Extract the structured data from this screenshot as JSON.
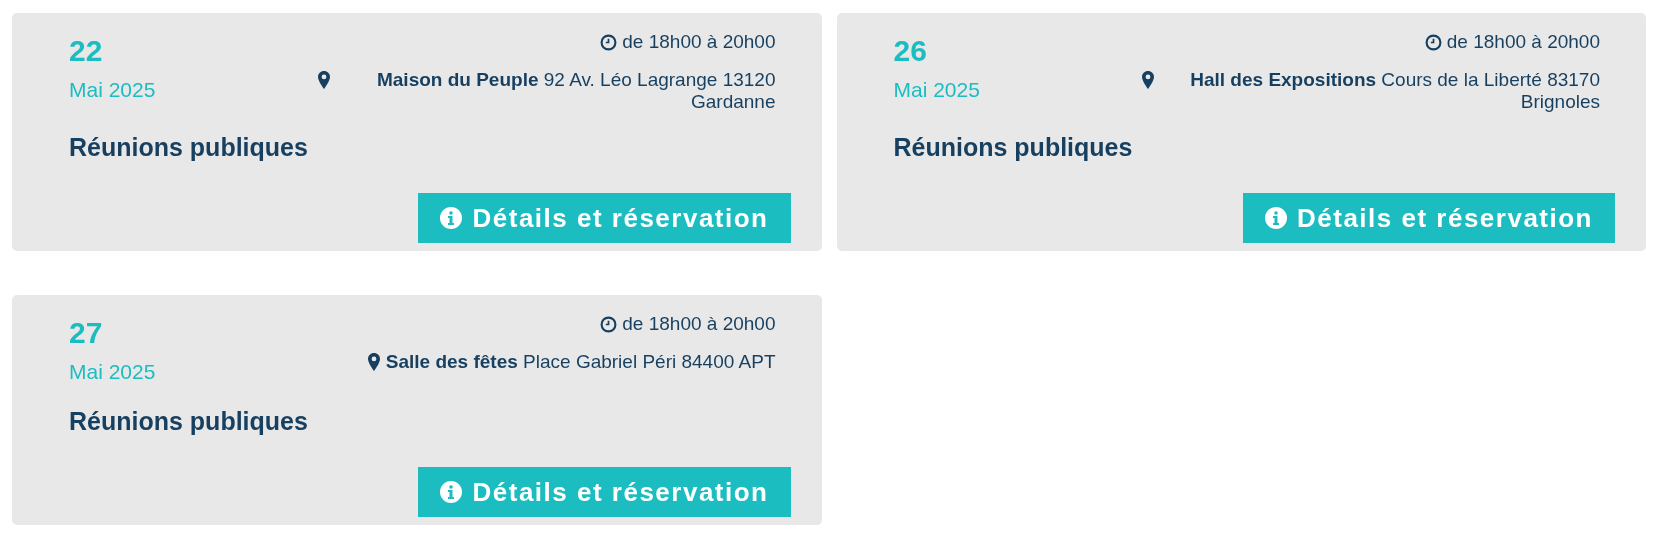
{
  "events": [
    {
      "day": "22",
      "month": "Mai 2025",
      "time": "de 18h00 à 20h00",
      "location": "**Maison du Peuple** 92 Av. Léo Lagrange 13120 Gardanne",
      "title": "Réunions publiques",
      "button": "Détails et réservation"
    },
    {
      "day": "26",
      "month": "Mai 2025",
      "time": "de 18h00 à 20h00",
      "location": "**Hall des Expositions** Cours de la Liberté 83170 Brignoles",
      "title": "Réunions publiques",
      "button": "Détails et réservation"
    },
    {
      "day": "27",
      "month": "Mai 2025",
      "time": "de 18h00 à 20h00",
      "location": "**Salle des fêtes** Place Gabriel Péri 84400 APT",
      "title": "Réunions publiques",
      "button": "Détails et réservation"
    }
  ]
}
